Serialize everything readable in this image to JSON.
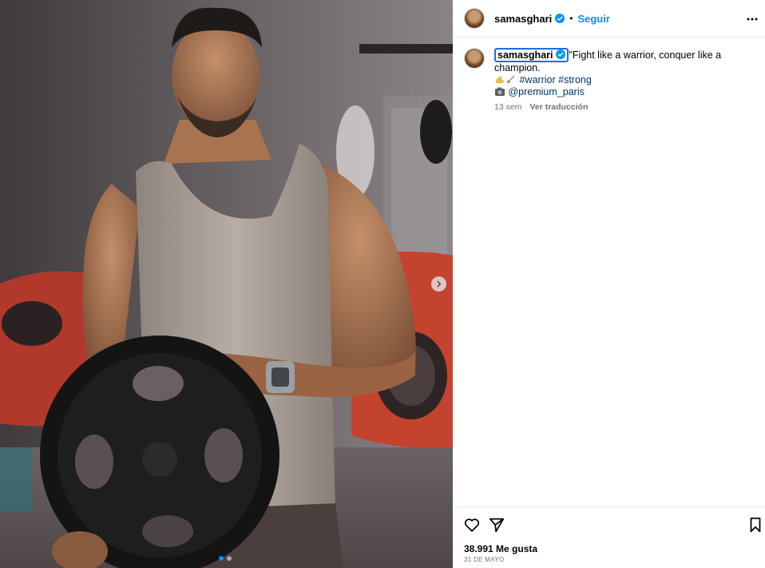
{
  "post": {
    "username": "samasghari",
    "verified": true,
    "separator": "•",
    "follow_label": "Seguir",
    "more_icon": "more-horizontal-icon"
  },
  "caption": {
    "username": "samasghari",
    "text": "\"Fight like a warrior, conquer like a champion.",
    "hashtag_1": "#warrior",
    "hashtag_2": "#strong",
    "mention": "@premium_paris",
    "time_ago": "13 sem",
    "translate_label": "Ver traducción"
  },
  "media": {
    "carousel_count": 2,
    "active_index": 0
  },
  "actions": {
    "like_icon": "heart-icon",
    "share_icon": "send-icon",
    "save_icon": "bookmark-icon"
  },
  "stats": {
    "likes": "38.991 Me gusta",
    "date": "31 DE MAYO"
  },
  "colors": {
    "link_blue": "#0095f6",
    "hashtag_blue": "#00376b",
    "muted": "#737373",
    "verified_blue": "#0095f6"
  }
}
